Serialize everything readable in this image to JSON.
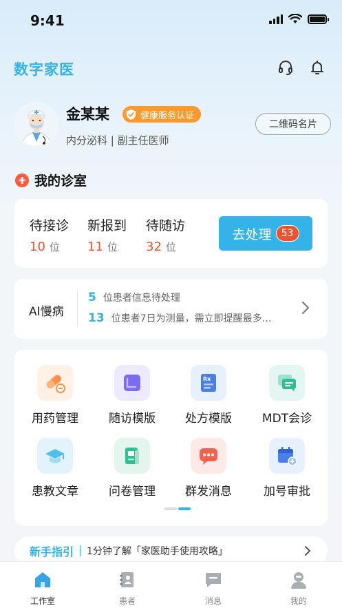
{
  "status_bar": {
    "time": "9:41"
  },
  "header": {
    "app_title": "数字家医",
    "headset_icon": "headset-icon",
    "bell_icon": "bell-icon"
  },
  "profile": {
    "name": "金某某",
    "badge": "健康服务认证",
    "department": "内分泌科 | 副主任医师",
    "qr_button": "二维码名片"
  },
  "clinic": {
    "title": "我的诊室",
    "stats": [
      {
        "label": "待接诊",
        "value": "10",
        "unit": "位"
      },
      {
        "label": "新报到",
        "value": "11",
        "unit": "位"
      },
      {
        "label": "待随访",
        "value": "32",
        "unit": "位"
      }
    ],
    "action_label": "去处理",
    "action_count": "53"
  },
  "ai": {
    "label": "AI慢病",
    "line1_num": "5",
    "line1_text": "位患者信息待处理",
    "line2_num": "13",
    "line2_text": "位患者7日为测量，需立即提醒最多…"
  },
  "features": [
    {
      "label": "用药管理",
      "icon": "medicine-icon"
    },
    {
      "label": "随访模版",
      "icon": "follow-up-template-icon"
    },
    {
      "label": "处方模版",
      "icon": "prescription-icon"
    },
    {
      "label": "MDT会诊",
      "icon": "mdt-consultation-icon"
    },
    {
      "label": "患教文章",
      "icon": "education-cap-icon"
    },
    {
      "label": "问卷管理",
      "icon": "questionnaire-icon"
    },
    {
      "label": "群发消息",
      "icon": "group-message-icon"
    },
    {
      "label": "加号审批",
      "icon": "calendar-plus-icon"
    }
  ],
  "pager": {
    "current_page": 2,
    "total_pages": 2
  },
  "guide": {
    "title": "新手指引",
    "text": "1分钟了解「家医助手使用攻略」"
  },
  "tabs": [
    {
      "label": "工作室",
      "icon": "home-icon",
      "active": true
    },
    {
      "label": "患者",
      "icon": "patients-icon",
      "active": false
    },
    {
      "label": "消息",
      "icon": "message-icon",
      "active": false
    },
    {
      "label": "我的",
      "icon": "profile-icon",
      "active": false
    }
  ],
  "colors": {
    "accent": "#36b3e6",
    "alert": "#f0522f",
    "badge": "#fe9a2c"
  }
}
